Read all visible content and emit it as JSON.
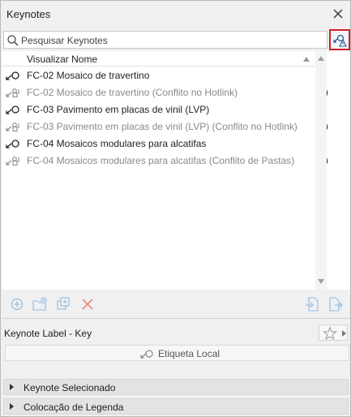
{
  "window": {
    "title": "Keynotes"
  },
  "search": {
    "placeholder": "Pesquisar Keynotes"
  },
  "list": {
    "column_header": "Visualizar Nome",
    "items": [
      {
        "name": "FC-02 Mosaico de travertino",
        "style": "normal",
        "icon": "keynote-link-icon",
        "info": false
      },
      {
        "name": "FC-02 Mosaico de travertino (Conflito no Hotlink)",
        "style": "dim",
        "icon": "keynote-conflict-icon",
        "info": true
      },
      {
        "name": "FC-03 Pavimento em placas de vinil (LVP)",
        "style": "normal",
        "icon": "keynote-link-icon",
        "info": false
      },
      {
        "name": "FC-03 Pavimento em placas de vinil (LVP) (Conflito no Hotlink)",
        "style": "dim",
        "icon": "keynote-conflict-icon",
        "info": true
      },
      {
        "name": "FC-04 Mosaicos modulares para alcatifas",
        "style": "normal",
        "icon": "keynote-link-icon",
        "info": false
      },
      {
        "name": "FC-04 Mosaicos modulares para alcatifas (Conflito de Pastas)",
        "style": "dim",
        "icon": "keynote-conflict-icon",
        "info": true
      }
    ]
  },
  "keynote_label": {
    "title": "Keynote Label - Key",
    "local_button": "Etiqueta Local"
  },
  "sections": [
    {
      "label": "Keynote Selecionado"
    },
    {
      "label": "Colocação de Legenda"
    }
  ],
  "colors": {
    "highlight_border": "#d4202a",
    "icon_blue": "#3d86c6",
    "delete_red": "#e8483f"
  }
}
